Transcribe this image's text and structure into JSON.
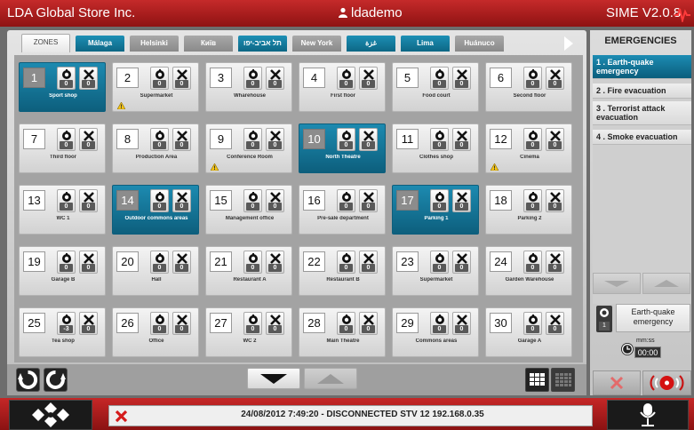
{
  "topbar": {
    "company": "LDA Global Store Inc.",
    "user": "ldademo",
    "version": "SIME V2.0.8"
  },
  "tabs": [
    {
      "label": "ZONES",
      "state": "active"
    },
    {
      "label": "Málaga",
      "state": "blue"
    },
    {
      "label": "Helsinki",
      "state": "gray"
    },
    {
      "label": "Київ",
      "state": "gray"
    },
    {
      "label": "תל אביב-יפו",
      "state": "blue"
    },
    {
      "label": "New York",
      "state": "gray"
    },
    {
      "label": "غزة",
      "state": "blue"
    },
    {
      "label": "Lima",
      "state": "blue"
    },
    {
      "label": "Huánuco",
      "state": "gray"
    }
  ],
  "zones": [
    {
      "num": "1",
      "name": "Sport shop",
      "a": "0",
      "b": "0",
      "selected": true,
      "warn": false
    },
    {
      "num": "2",
      "name": "Supermarket",
      "a": "0",
      "b": "0",
      "selected": false,
      "warn": true
    },
    {
      "num": "3",
      "name": "Wharehouse",
      "a": "0",
      "b": "0",
      "selected": false,
      "warn": false
    },
    {
      "num": "4",
      "name": "First floor",
      "a": "0",
      "b": "0",
      "selected": false,
      "warn": false
    },
    {
      "num": "5",
      "name": "Food court",
      "a": "0",
      "b": "0",
      "selected": false,
      "warn": false
    },
    {
      "num": "6",
      "name": "Second floor",
      "a": "0",
      "b": "0",
      "selected": false,
      "warn": false
    },
    {
      "num": "7",
      "name": "Third floor",
      "a": "0",
      "b": "0",
      "selected": false,
      "warn": false
    },
    {
      "num": "8",
      "name": "Production Area",
      "a": "0",
      "b": "0",
      "selected": false,
      "warn": false
    },
    {
      "num": "9",
      "name": "Conference Room",
      "a": "0",
      "b": "0",
      "selected": false,
      "warn": true
    },
    {
      "num": "10",
      "name": "North Theatre",
      "a": "0",
      "b": "0",
      "selected": true,
      "warn": false
    },
    {
      "num": "11",
      "name": "Clothes shop",
      "a": "0",
      "b": "0",
      "selected": false,
      "warn": false
    },
    {
      "num": "12",
      "name": "Cinema",
      "a": "0",
      "b": "0",
      "selected": false,
      "warn": true
    },
    {
      "num": "13",
      "name": "WC 1",
      "a": "0",
      "b": "0",
      "selected": false,
      "warn": false
    },
    {
      "num": "14",
      "name": "Outdoor commons areas",
      "a": "0",
      "b": "0",
      "selected": true,
      "warn": false
    },
    {
      "num": "15",
      "name": "Management office",
      "a": "0",
      "b": "0",
      "selected": false,
      "warn": false
    },
    {
      "num": "16",
      "name": "Pre-sale department",
      "a": "0",
      "b": "0",
      "selected": false,
      "warn": false
    },
    {
      "num": "17",
      "name": "Parking 1",
      "a": "0",
      "b": "0",
      "selected": true,
      "warn": false
    },
    {
      "num": "18",
      "name": "Parking 2",
      "a": "0",
      "b": "0",
      "selected": false,
      "warn": false
    },
    {
      "num": "19",
      "name": "Garage B",
      "a": "0",
      "b": "0",
      "selected": false,
      "warn": false
    },
    {
      "num": "20",
      "name": "Hall",
      "a": "0",
      "b": "0",
      "selected": false,
      "warn": false
    },
    {
      "num": "21",
      "name": "Restaurant A",
      "a": "0",
      "b": "0",
      "selected": false,
      "warn": false
    },
    {
      "num": "22",
      "name": "Restaurant B",
      "a": "0",
      "b": "0",
      "selected": false,
      "warn": false
    },
    {
      "num": "23",
      "name": "Supermarket",
      "a": "0",
      "b": "0",
      "selected": false,
      "warn": false
    },
    {
      "num": "24",
      "name": "Garden Warehouse",
      "a": "0",
      "b": "0",
      "selected": false,
      "warn": false
    },
    {
      "num": "25",
      "name": "Tea shop",
      "a": "-3",
      "b": "0",
      "selected": false,
      "warn": false
    },
    {
      "num": "26",
      "name": "Office",
      "a": "0",
      "b": "0",
      "selected": false,
      "warn": false
    },
    {
      "num": "27",
      "name": "WC 2",
      "a": "0",
      "b": "0",
      "selected": false,
      "warn": false
    },
    {
      "num": "28",
      "name": "Main Theatre",
      "a": "0",
      "b": "0",
      "selected": false,
      "warn": false
    },
    {
      "num": "29",
      "name": "Commons areas",
      "a": "0",
      "b": "0",
      "selected": false,
      "warn": false
    },
    {
      "num": "30",
      "name": "Garage A",
      "a": "0",
      "b": "0",
      "selected": false,
      "warn": false
    }
  ],
  "emergencies": {
    "title": "EMERGENCIES",
    "items": [
      {
        "label": "1 . Earth-quake emergency",
        "active": true
      },
      {
        "label": "2 . Fire evacuation",
        "active": false
      },
      {
        "label": "3 . Terrorist attack evacuation",
        "active": false
      },
      {
        "label": "4 . Smoke evacuation",
        "active": false
      }
    ],
    "current": {
      "name": "Earth-quake emergency",
      "num": "1"
    },
    "timer": {
      "label": "mm:ss",
      "value": "00:00"
    }
  },
  "status": {
    "message": "24/08/2012 7:49:20 - DISCONNECTED STV 12 192.168.0.35"
  },
  "colors": {
    "brand_red": "#b01c1c",
    "selected_blue": "#0d6785",
    "warning": "#f5c518"
  }
}
